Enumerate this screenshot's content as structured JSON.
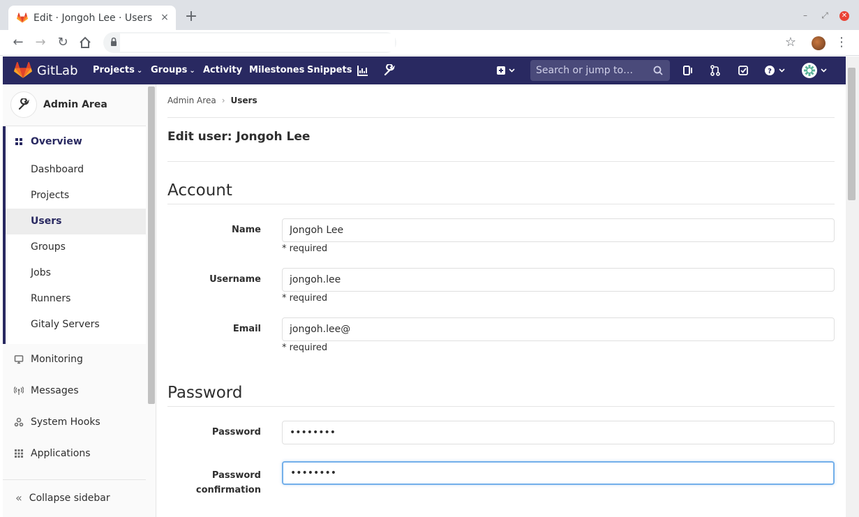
{
  "browser": {
    "tab_title": "Edit · Jongoh Lee · Users",
    "tab_close": "×",
    "new_tab": "+",
    "url": ""
  },
  "header": {
    "brand": "GitLab",
    "nav": {
      "projects": "Projects",
      "groups": "Groups",
      "activity": "Activity",
      "milestones": "Milestones",
      "snippets": "Snippets"
    },
    "search_placeholder": "Search or jump to…"
  },
  "sidebar": {
    "title": "Admin Area",
    "overview": "Overview",
    "sub_items": [
      "Dashboard",
      "Projects",
      "Users",
      "Groups",
      "Jobs",
      "Runners",
      "Gitaly Servers"
    ],
    "items": [
      "Monitoring",
      "Messages",
      "System Hooks",
      "Applications"
    ],
    "collapse": "Collapse sidebar"
  },
  "main": {
    "breadcrumb": {
      "root": "Admin Area",
      "current": "Users",
      "separator": "›"
    },
    "title": "Edit user: Jongoh Lee",
    "account_heading": "Account",
    "password_heading": "Password",
    "fields": {
      "name": {
        "label": "Name",
        "value": "Jongoh Lee",
        "help": "* required"
      },
      "username": {
        "label": "Username",
        "value": "jongoh.lee",
        "help": "* required"
      },
      "email": {
        "label": "Email",
        "value": "jongoh.lee@",
        "help": "* required"
      },
      "password": {
        "label": "Password",
        "value": "••••••••"
      },
      "password_confirmation": {
        "label_line1": "Password",
        "label_line2": "confirmation",
        "value": "••••••••"
      }
    }
  },
  "colors": {
    "header_bg": "#292961",
    "focus_border": "#73afea"
  }
}
